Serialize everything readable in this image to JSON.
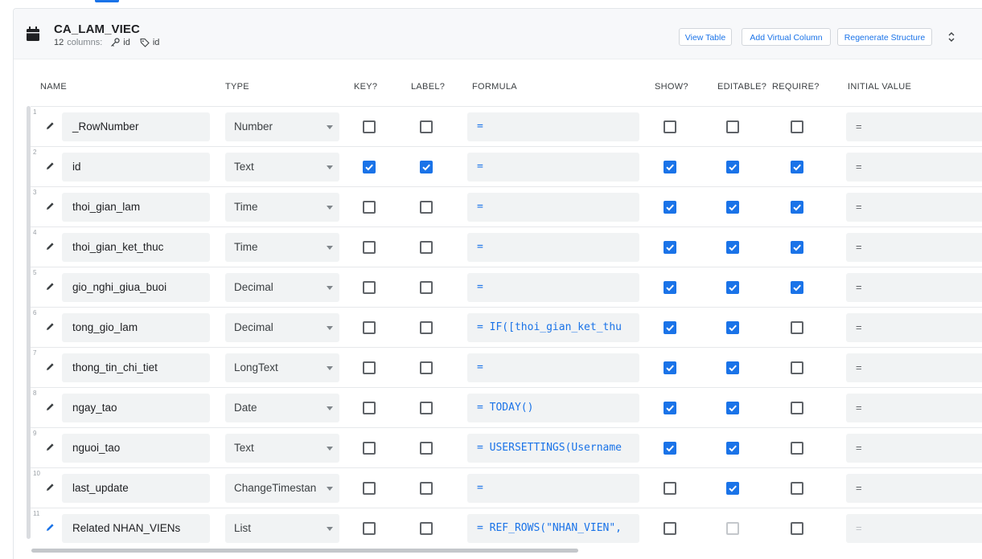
{
  "table": {
    "title": "CA_LAM_VIEC",
    "columns_count": "12",
    "columns_suffix": "columns:",
    "key_column": "id",
    "label_column": "id"
  },
  "header_buttons": {
    "view_table": "View Table",
    "add_virtual_column": "Add Virtual Column",
    "regenerate_structure": "Regenerate Structure"
  },
  "column_headers": {
    "name": "NAME",
    "type": "TYPE",
    "key": "KEY?",
    "label": "LABEL?",
    "formula": "FORMULA",
    "show": "SHOW?",
    "editable": "EDITABLE?",
    "require": "REQUIRE?",
    "initial_value": "INITIAL VALUE"
  },
  "colors": {
    "accent": "#1a73e8",
    "field_bg": "#f1f3f4",
    "header_bg": "#f7f8fa"
  },
  "rows": [
    {
      "num": "1",
      "name": "_RowNumber",
      "type": "Number",
      "key": false,
      "label": false,
      "formula": "=",
      "show": false,
      "editable": false,
      "require": false,
      "initial": "="
    },
    {
      "num": "2",
      "name": "id",
      "type": "Text",
      "key": true,
      "label": true,
      "formula": "=",
      "show": true,
      "editable": true,
      "require": true,
      "initial": "="
    },
    {
      "num": "3",
      "name": "thoi_gian_lam",
      "type": "Time",
      "key": false,
      "label": false,
      "formula": "=",
      "show": true,
      "editable": true,
      "require": true,
      "initial": "="
    },
    {
      "num": "4",
      "name": "thoi_gian_ket_thuc",
      "type": "Time",
      "key": false,
      "label": false,
      "formula": "=",
      "show": true,
      "editable": true,
      "require": true,
      "initial": "="
    },
    {
      "num": "5",
      "name": "gio_nghi_giua_buoi",
      "type": "Decimal",
      "key": false,
      "label": false,
      "formula": "=",
      "show": true,
      "editable": true,
      "require": true,
      "initial": "="
    },
    {
      "num": "6",
      "name": "tong_gio_lam",
      "type": "Decimal",
      "key": false,
      "label": false,
      "formula": "= IF([thoi_gian_ket_thu",
      "show": true,
      "editable": true,
      "require": false,
      "initial": "="
    },
    {
      "num": "7",
      "name": "thong_tin_chi_tiet",
      "type": "LongText",
      "key": false,
      "label": false,
      "formula": "=",
      "show": true,
      "editable": true,
      "require": false,
      "initial": "="
    },
    {
      "num": "8",
      "name": "ngay_tao",
      "type": "Date",
      "key": false,
      "label": false,
      "formula": "= TODAY()",
      "show": true,
      "editable": true,
      "require": false,
      "initial": "="
    },
    {
      "num": "9",
      "name": "nguoi_tao",
      "type": "Text",
      "key": false,
      "label": false,
      "formula": "= USERSETTINGS(Username",
      "show": true,
      "editable": true,
      "require": false,
      "initial": "="
    },
    {
      "num": "10",
      "name": "last_update",
      "type": "ChangeTimestan",
      "key": false,
      "label": false,
      "formula": "=",
      "show": false,
      "editable": true,
      "require": false,
      "initial": "="
    },
    {
      "num": "11",
      "name": "Related NHAN_VIENs",
      "type": "List",
      "key": false,
      "label": false,
      "formula": "= REF_ROWS(\"NHAN_VIEN\",",
      "show": false,
      "editable": false,
      "require": false,
      "initial": "=",
      "virtual": true
    }
  ]
}
